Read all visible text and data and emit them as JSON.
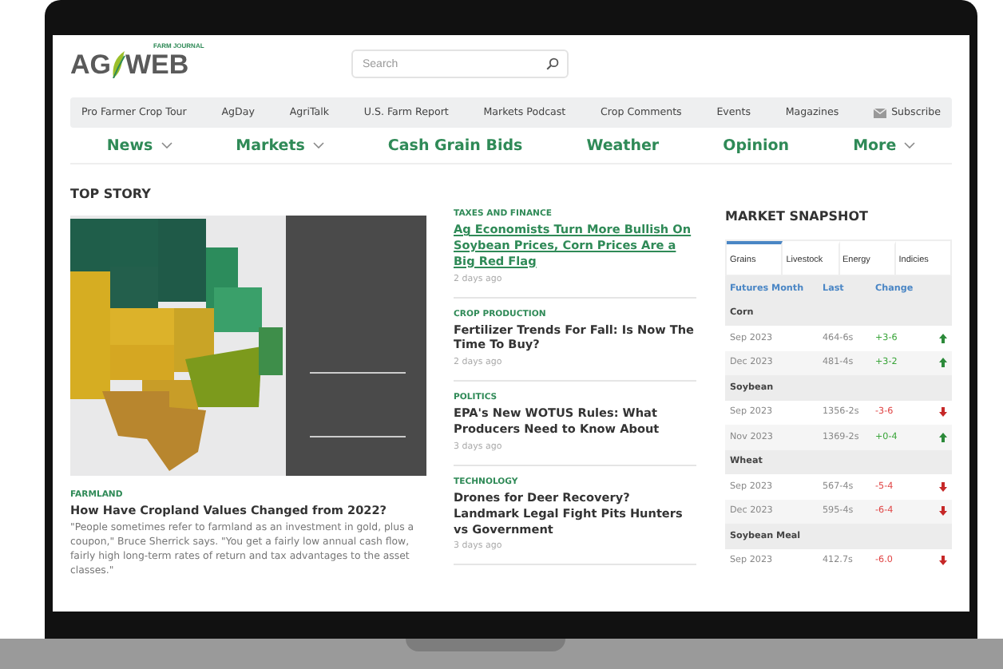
{
  "logo": {
    "brand_tag": "FARM JOURNAL",
    "left": "AG",
    "right": "WEB"
  },
  "search": {
    "placeholder": "Search"
  },
  "utility_links": [
    "Pro Farmer Crop Tour",
    "AgDay",
    "AgriTalk",
    "U.S. Farm Report",
    "Markets Podcast",
    "Crop Comments",
    "Events",
    "Magazines"
  ],
  "subscribe": "Subscribe",
  "main_nav": [
    {
      "label": "News",
      "dropdown": true
    },
    {
      "label": "Markets",
      "dropdown": true
    },
    {
      "label": "Cash Grain Bids",
      "dropdown": false
    },
    {
      "label": "Weather",
      "dropdown": false
    },
    {
      "label": "Opinion",
      "dropdown": false
    },
    {
      "label": "More",
      "dropdown": true
    }
  ],
  "top_story": {
    "heading": "TOP STORY",
    "category": "FARMLAND",
    "title": "How Have Cropland Values Changed from 2022?",
    "summary": "\"People sometimes refer to farmland as an investment in gold, plus a coupon,\" Bruce Sherrick says. \"You get a fairly low annual cash flow, fairly high long-term rates of return and tax advantages to the asset classes.\""
  },
  "articles": [
    {
      "category": "TAXES AND FINANCE",
      "title": "Ag Economists Turn More Bullish On Soybean Prices, Corn Prices Are a Big Red Flag",
      "time": "2 days ago",
      "highlighted": true
    },
    {
      "category": "CROP PRODUCTION",
      "title": "Fertilizer Trends For Fall: Is Now The Time To Buy?",
      "time": "2 days ago",
      "highlighted": false
    },
    {
      "category": "POLITICS",
      "title": "EPA's New WOTUS Rules: What Producers Need to Know About",
      "time": "3 days ago",
      "highlighted": false
    },
    {
      "category": "TECHNOLOGY",
      "title": "Drones for Deer Recovery? Landmark Legal Fight Pits Hunters vs Government",
      "time": "3 days ago",
      "highlighted": false
    }
  ],
  "market_snapshot": {
    "title": "MARKET SNAPSHOT",
    "tabs": [
      {
        "label": "Grains",
        "selected": true
      },
      {
        "label": "Livestock",
        "selected": false
      },
      {
        "label": "Energy",
        "selected": false
      },
      {
        "label": "Indicies",
        "selected": false
      }
    ],
    "columns": [
      "Futures Month",
      "Last",
      "Change"
    ],
    "groups": [
      {
        "name": "Corn",
        "rows": [
          {
            "month": "Sep 2023",
            "last": "464-6s",
            "change": "+3-6",
            "rising": true
          },
          {
            "month": "Dec 2023",
            "last": "481-4s",
            "change": "+3-2",
            "rising": true
          }
        ]
      },
      {
        "name": "Soybean",
        "rows": [
          {
            "month": "Sep 2023",
            "last": "1356-2s",
            "change": "-3-6",
            "rising": false
          },
          {
            "month": "Nov 2023",
            "last": "1369-2s",
            "change": "+0-4",
            "rising": true
          }
        ]
      },
      {
        "name": "Wheat",
        "rows": [
          {
            "month": "Sep 2023",
            "last": "567-4s",
            "change": "-5-4",
            "rising": false
          },
          {
            "month": "Dec 2023",
            "last": "595-4s",
            "change": "-6-4",
            "rising": false
          }
        ]
      },
      {
        "name": "Soybean Meal",
        "rows": [
          {
            "month": "Sep 2023",
            "last": "412.7s",
            "change": "-6.0",
            "rising": false
          }
        ]
      }
    ]
  }
}
